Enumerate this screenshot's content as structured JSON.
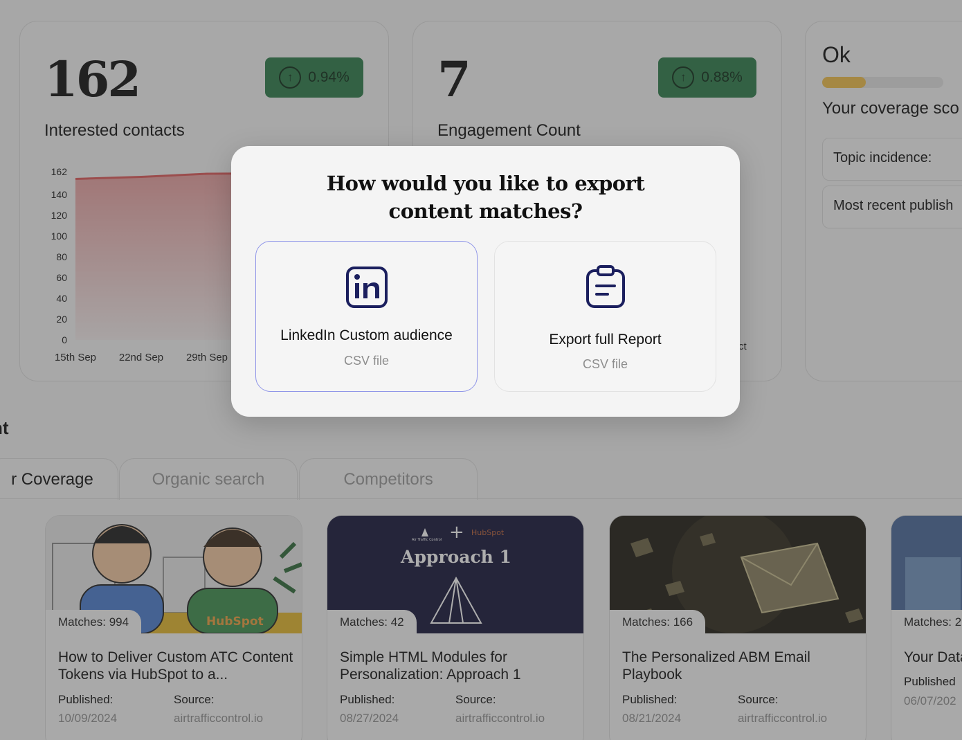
{
  "stats": [
    {
      "value": "162",
      "change": "0.94%",
      "label": "Interested contacts"
    },
    {
      "value": "7",
      "change": "0.88%",
      "label": "Engagement Count"
    }
  ],
  "chart_data": {
    "type": "area",
    "x": [
      "15th Sep",
      "22nd Sep",
      "29th Sep"
    ],
    "y_ticks": [
      "162",
      "140",
      "120",
      "100",
      "80",
      "60",
      "40",
      "20",
      "0"
    ],
    "series": [
      {
        "values": [
          155,
          157,
          160
        ]
      }
    ],
    "ylim": [
      0,
      162
    ],
    "color": "#e05a5a"
  },
  "chart2_partial_tick": "ct",
  "coverage": {
    "title": "Ok",
    "level": 0.36,
    "label": "Your coverage sco",
    "rows": [
      "Topic incidence:",
      "Most recent publish"
    ]
  },
  "section_title": "nt",
  "tabs": [
    "r Coverage",
    "Organic search",
    "Competitors"
  ],
  "content_cards": [
    {
      "matches": "Matches: 994",
      "title": "How to Deliver Custom ATC Content Tokens via HubSpot to a...",
      "published_label": "Published:",
      "published": "10/09/2024",
      "source_label": "Source:",
      "source": "airtrafficcontrol.io"
    },
    {
      "matches": "Matches: 42",
      "title": "Simple HTML Modules for Personalization: Approach 1",
      "published_label": "Published:",
      "published": "08/27/2024",
      "source_label": "Source:",
      "source": "airtrafficcontrol.io",
      "thumb_text": "Approach 1",
      "thumb_brand": "HubSpot",
      "thumb_small": "Air Traffic Control"
    },
    {
      "matches": "Matches: 166",
      "title": "The Personalized ABM Email Playbook",
      "published_label": "Published:",
      "published": "08/21/2024",
      "source_label": "Source:",
      "source": "airtrafficcontrol.io"
    },
    {
      "matches": "Matches: 2",
      "title": "Your Data",
      "published_label": "Published",
      "published": "06/07/202",
      "source_label": "",
      "source": ""
    }
  ],
  "modal": {
    "title_line1": "How would you like to export",
    "title_line2": "content matches?",
    "options": [
      {
        "icon": "linkedin-icon",
        "label": "LinkedIn Custom audience",
        "sub": "CSV file"
      },
      {
        "icon": "clipboard-icon",
        "label": "Export full Report",
        "sub": "CSV file"
      }
    ]
  },
  "colors": {
    "accent_border": "#8f95e8",
    "badge": "#2e7d4a",
    "coverage_bar": "#f1c04a",
    "icon": "#1b1f5e"
  }
}
